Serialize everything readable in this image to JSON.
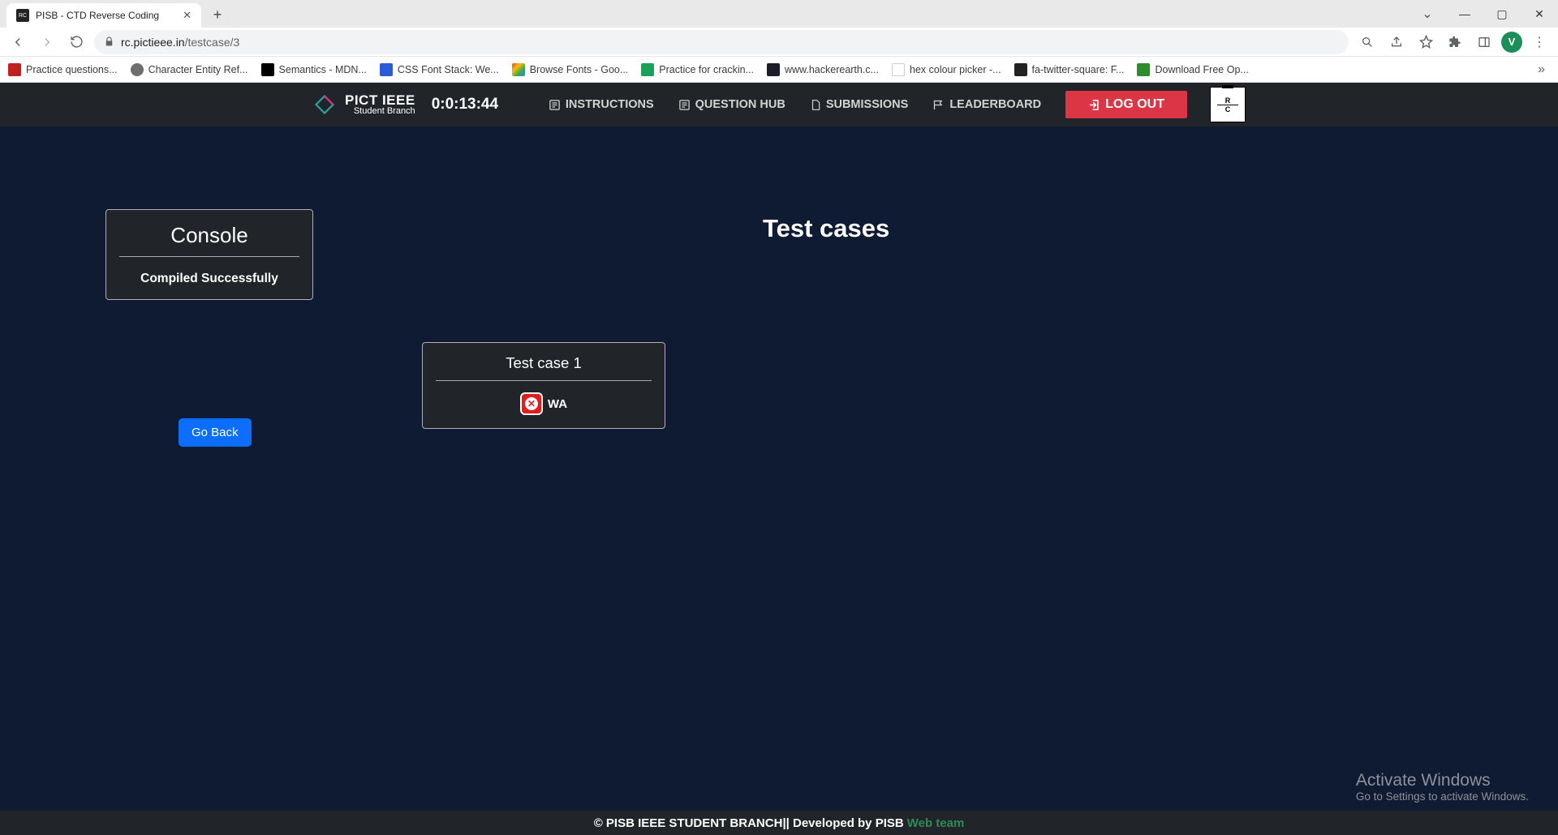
{
  "browser": {
    "tab_title": "PISB - CTD Reverse Coding",
    "url_host": "rc.pictieee.in",
    "url_path": "/testcase/3",
    "avatar_letter": "V"
  },
  "bookmarks": [
    {
      "label": "Practice questions..."
    },
    {
      "label": "Character Entity Ref..."
    },
    {
      "label": "Semantics - MDN..."
    },
    {
      "label": "CSS Font Stack: We..."
    },
    {
      "label": "Browse Fonts - Goo..."
    },
    {
      "label": "Practice for crackin..."
    },
    {
      "label": "www.hackerearth.c..."
    },
    {
      "label": "hex colour picker -..."
    },
    {
      "label": "fa-twitter-square: F..."
    },
    {
      "label": "Download Free Op..."
    }
  ],
  "navbar": {
    "brand_main": "PICT IEEE",
    "brand_sub": "Student Branch",
    "timer": "0:0:13:44",
    "items": {
      "instructions": "INSTRUCTIONS",
      "question_hub": "QUESTION HUB",
      "submissions": "SUBMISSIONS",
      "leaderboard": "LEADERBOARD"
    },
    "logout": "LOG OUT"
  },
  "console": {
    "title": "Console",
    "message": "Compiled Successfully"
  },
  "testcases": {
    "heading": "Test cases",
    "case_title": "Test case 1",
    "status": "WA"
  },
  "go_back": "Go Back",
  "footer": {
    "left": "© PISB IEEE STUDENT BRANCH",
    "mid": " || Developed by PISB ",
    "webteam": "Web team"
  },
  "activate": {
    "line1": "Activate Windows",
    "line2": "Go to Settings to activate Windows."
  }
}
